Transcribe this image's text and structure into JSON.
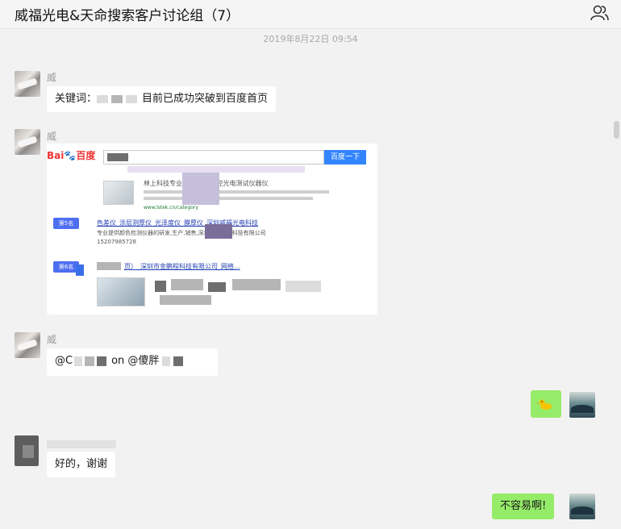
{
  "header": {
    "title": "威福光电&天命搜索客户讨论组（7）"
  },
  "timestamp": "2019年8月22日 09:54",
  "messages": [
    {
      "sender": "威",
      "prefix": "关键词：",
      "suffix": "目前已成功突破到百度首页"
    },
    {
      "sender": "威",
      "type": "image"
    },
    {
      "sender": "威",
      "prefix": "@C",
      "mid": "on @傻胖"
    },
    {
      "self": true,
      "type": "emoji"
    },
    {
      "text": "好的，谢谢"
    },
    {
      "self": true,
      "text": "不容易啊!"
    }
  ],
  "screenshot": {
    "search_button": "百度一下",
    "results": [
      {
        "rank": "第5名",
        "title": "色差仪_涂层测厚仪_光泽度仪_膜厚仪_深圳威福光电科技",
        "url": "www.lstek.cn/category"
      },
      {
        "rank": "第6名",
        "title": "页）_深圳市金鹏程科技有限公司_网络..."
      }
    ],
    "snippet_1": "林上科技专业生产厂家,遥控光电测试仪器仪",
    "snippet_2": "专业提供颜色检测仪器的研发,生产,销售,深圳威福光电科技有限公司",
    "phone": "15207985728"
  },
  "colors": {
    "self_bubble": "#95ec69",
    "baidu_red": "#e33333",
    "baidu_blue": "#3385ff"
  }
}
